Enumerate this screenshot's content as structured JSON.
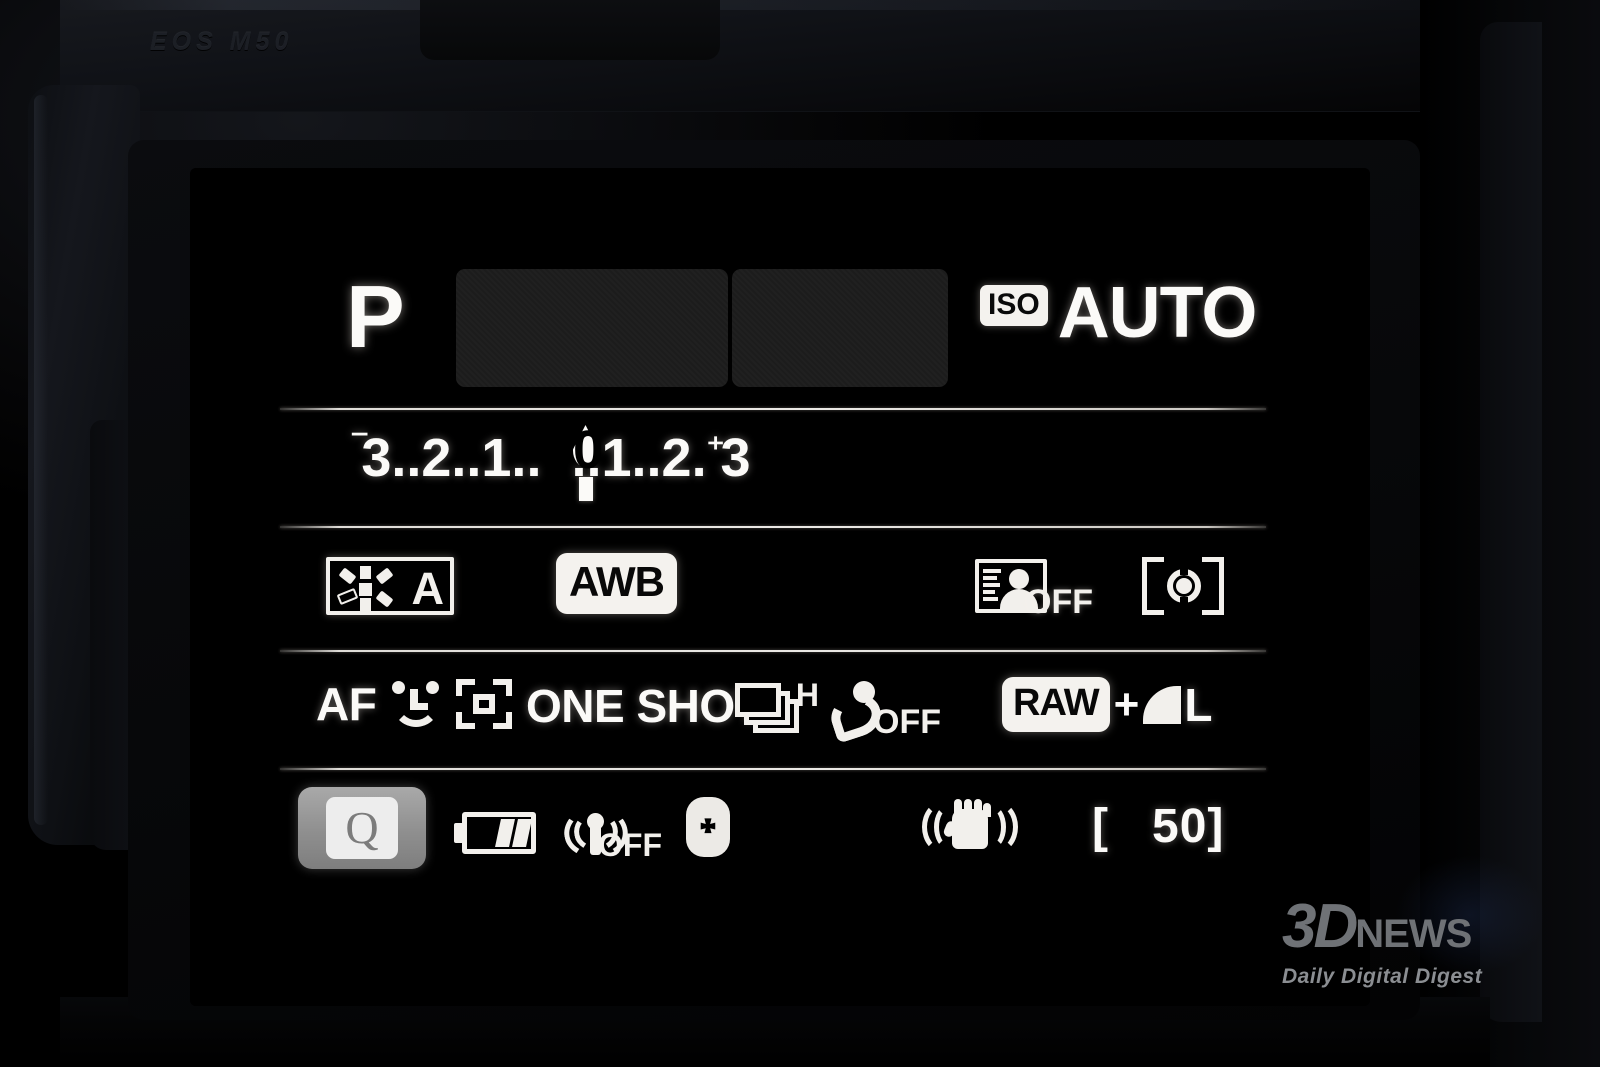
{
  "camera": {
    "model_label": "EOS M50"
  },
  "display": {
    "shooting_mode": "P",
    "shutter_field": "",
    "aperture_field": "",
    "iso_badge": "ISO",
    "iso_value": "AUTO",
    "exposure_compensation": {
      "scale": "3..2..1..0..1..2.3",
      "minus_sign": "‾",
      "plus_sign": "⁺",
      "left_part": "3..2..1..",
      "right_part": "..1..2.",
      "zero": "0",
      "right_end": "3",
      "current_value": "0"
    },
    "picture_style": {
      "icon": "picture-style-auto-icon",
      "label": "A"
    },
    "white_balance": "AWB",
    "auto_lighting_optimizer": {
      "icon": "auto-lighting-optimizer-icon",
      "state": "OFF"
    },
    "metering_mode": {
      "icon": "evaluative-metering-icon"
    },
    "autofocus": {
      "label": "AF",
      "face_icon": "face-tracking-icon",
      "frame_icon": "af-area-frame-icon"
    },
    "af_operation": "ONE SHOT",
    "drive_mode": {
      "icon": "continuous-shooting-icon",
      "speed": "H"
    },
    "self_timer": {
      "icon": "self-timer-icon",
      "state": "OFF"
    },
    "image_quality": {
      "raw": "RAW",
      "plus": "+",
      "fine_icon": "fine-quality-icon",
      "size": "L"
    },
    "quick_menu": {
      "label": "Q"
    },
    "battery": {
      "icon": "battery-icon"
    },
    "wifi": {
      "icon": "wifi-icon",
      "state": "OFF"
    },
    "bluetooth": {
      "icon": "bluetooth-icon",
      "glyph": "᛭"
    },
    "image_stabilizer": {
      "icon": "image-stabilizer-icon"
    },
    "remaining_shots": "[   50]"
  },
  "watermark": {
    "main": "3D",
    "news": "NEWS",
    "tagline": "Daily Digital Digest"
  },
  "colors": {
    "lcd_text": "#fbfaf8",
    "lcd_background": "#000000",
    "field_box": "#1c1c1c",
    "q_button": "#8f8f8f",
    "watermark": "#6f7276"
  }
}
